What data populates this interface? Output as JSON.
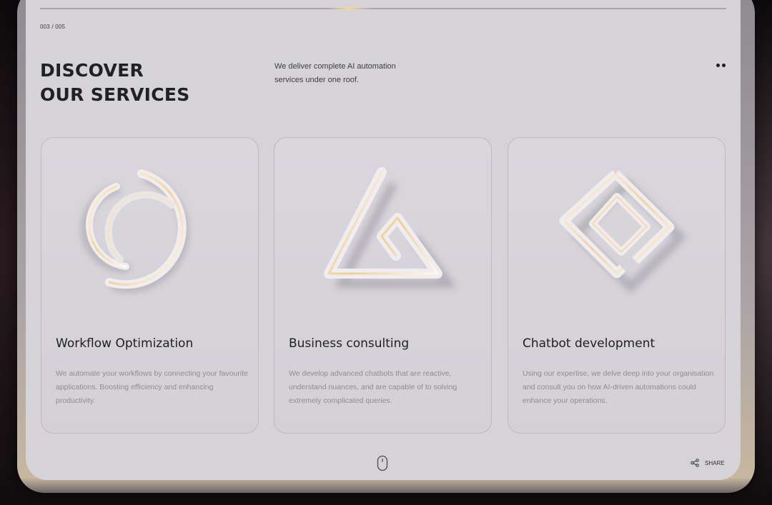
{
  "header": {
    "page_counter": "003 / 005",
    "title_line1": "DISCOVER",
    "title_line2": "OUR SERVICES",
    "intro": "We deliver complete AI automation services under one roof."
  },
  "cards": [
    {
      "title": "Workflow Optimization",
      "description": "We automate your workflows by connecting your favourite applications. Boosting efficiency and enhancing productivity.",
      "icon": "ring-arcs-icon"
    },
    {
      "title": "Business consulting",
      "description": "We develop advanced chatbots that are reactive, understand nuances, and are capable of to solving extremely complicated queries.",
      "icon": "triangle-icon"
    },
    {
      "title": "Chatbot development",
      "description": "Using our expertise, we delve deep into your organisation and consult you on how AI-driven automations could enhance your operations.",
      "icon": "diamond-icon"
    }
  ],
  "footer": {
    "share_label": "SHARE"
  },
  "colors": {
    "screen_bg": "#d5d3d8",
    "accent_gold": "#f2d7a3",
    "text_dark": "#1f1e24",
    "text_muted": "#8e8b92"
  }
}
